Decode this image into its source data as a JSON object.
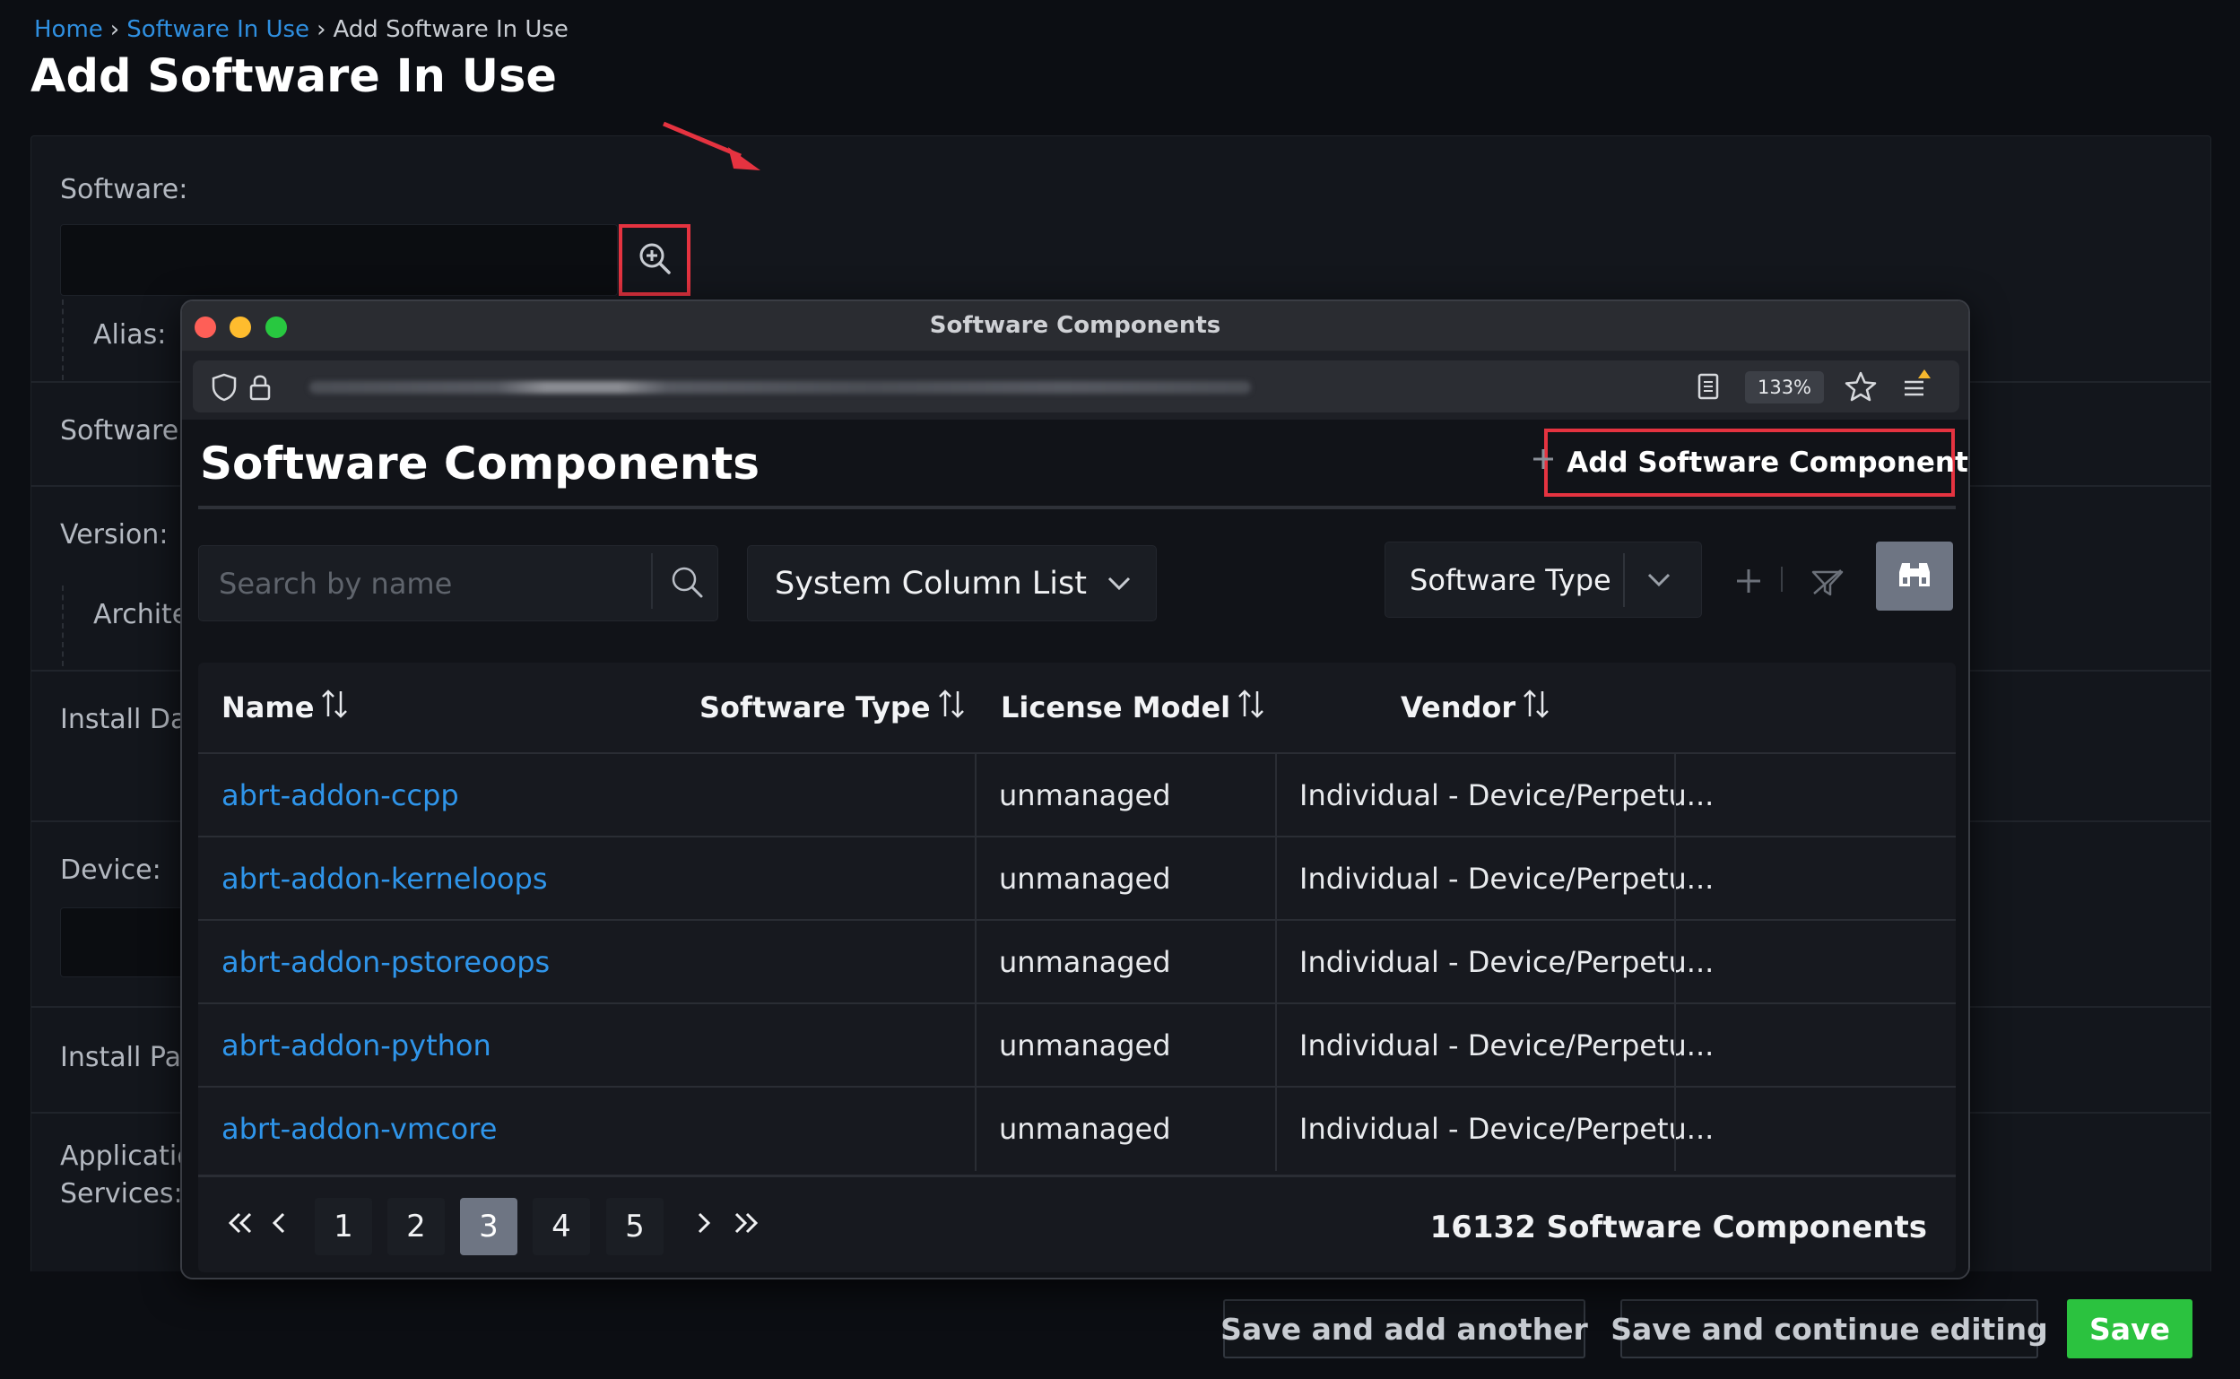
{
  "breadcrumb": {
    "home": "Home",
    "parent": "Software In Use",
    "current": "Add Software In Use",
    "separator": "›"
  },
  "page_title": "Add Software In Use",
  "form": {
    "software_label": "Software:",
    "alias_label": "Alias:",
    "software_row_label": "Software",
    "version_label": "Version:",
    "architecture_label": "Archite",
    "install_date_label": "Install Dat",
    "device_label": "Device:",
    "install_path_label": "Install Pat",
    "application_services_label_1": "Applicatio",
    "application_services_label_2": "Services:",
    "lookup_icon": "zoom-in-icon"
  },
  "actions": {
    "save_add_another": "Save and add another",
    "save_continue": "Save and continue editing",
    "save": "Save"
  },
  "popup": {
    "window_title": "Software Components",
    "zoom": "133%",
    "heading": "Software Components",
    "add_button": "Add Software Component",
    "search_placeholder": "Search by name",
    "column_list": "System Column List",
    "type_filter": "Software Type",
    "columns": [
      "Name",
      "Software Type",
      "License Model",
      "Vendor"
    ],
    "rows": [
      {
        "name": "abrt-addon-ccpp",
        "type": "unmanaged",
        "license": "Individual - Device/Perpetu...",
        "vendor": ""
      },
      {
        "name": "abrt-addon-kerneloops",
        "type": "unmanaged",
        "license": "Individual - Device/Perpetu...",
        "vendor": ""
      },
      {
        "name": "abrt-addon-pstoreoops",
        "type": "unmanaged",
        "license": "Individual - Device/Perpetu...",
        "vendor": ""
      },
      {
        "name": "abrt-addon-python",
        "type": "unmanaged",
        "license": "Individual - Device/Perpetu...",
        "vendor": ""
      },
      {
        "name": "abrt-addon-vmcore",
        "type": "unmanaged",
        "license": "Individual - Device/Perpetu...",
        "vendor": ""
      }
    ],
    "pagination": {
      "first": "«",
      "prev": "‹",
      "pages": [
        "1",
        "2",
        "3",
        "4",
        "5"
      ],
      "current_page": "3",
      "next": "›",
      "last": "»"
    },
    "total": "16132 Software Components"
  },
  "colors": {
    "accent_link": "#2f95ea",
    "highlight_red": "#e53340",
    "save_green": "#2bc23f",
    "active_page": "#6e7583"
  }
}
